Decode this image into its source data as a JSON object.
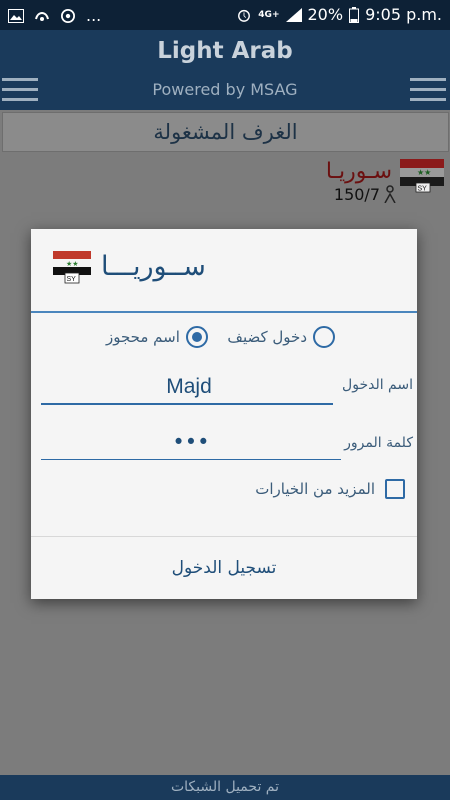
{
  "status_bar": {
    "battery_percent": "20%",
    "network": "4G+",
    "time": "9:05 p.m.",
    "dots": "..."
  },
  "app_bar": {
    "title": "Light Arab",
    "subtitle": "Powered by MSAG"
  },
  "rooms_header": "الغرف المشغولة",
  "room": {
    "name": "سـوريـا",
    "count": "150/7",
    "flag_badge": "SY"
  },
  "dialog": {
    "title": "ســوريـــا",
    "flag_badge": "SY",
    "radio_guest_label": "دخول كضيف",
    "radio_reserved_label": "اسم محجوز",
    "radio_selected": "اسم محجوز",
    "username_label": "اسم الدخول",
    "username_value": "Majd",
    "password_label": "كلمة المرور",
    "password_value": "•••",
    "more_options_label": "المزيد من الخيارات",
    "more_options_checked": false,
    "login_button": "تسجيل الدخول"
  },
  "bottom_bar": "تم تحميل الشبكات",
  "colors": {
    "app_bar": "#1a3a5b",
    "accent": "#2e6aa5",
    "room_name": "#6b1010"
  }
}
